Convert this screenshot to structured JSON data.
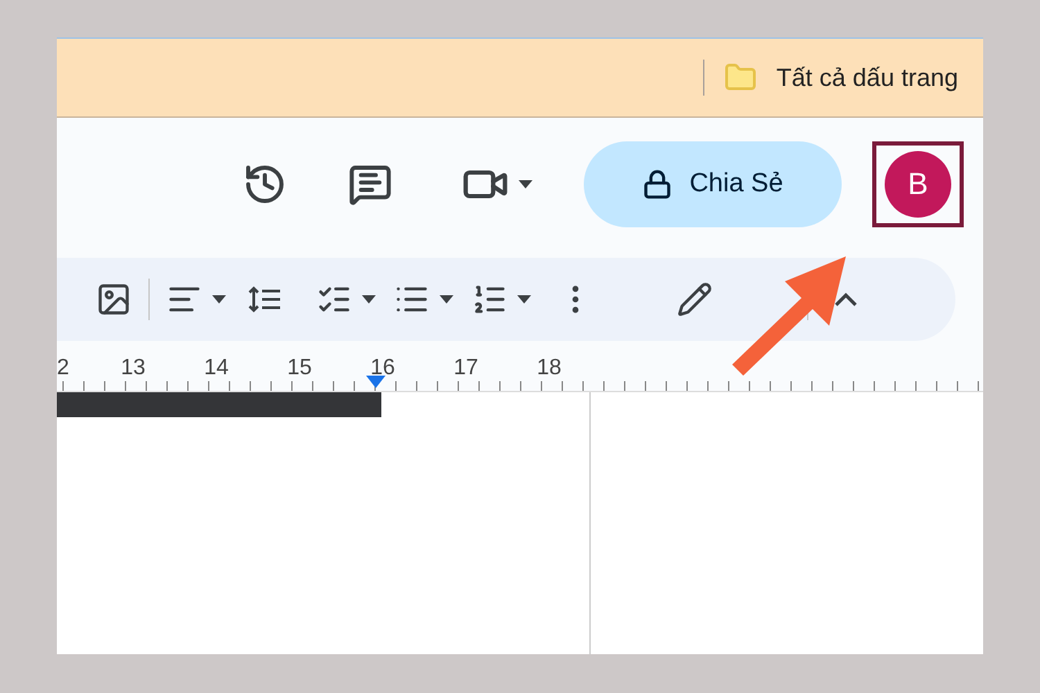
{
  "bookmarks_bar": {
    "label": "Tất cả dấu trang"
  },
  "header": {
    "share_button": {
      "label": "Chia Sẻ"
    },
    "avatar": {
      "letter": "B"
    }
  },
  "ruler": {
    "numbers": [
      "2",
      "13",
      "14",
      "15",
      "16",
      "17",
      "18"
    ]
  }
}
